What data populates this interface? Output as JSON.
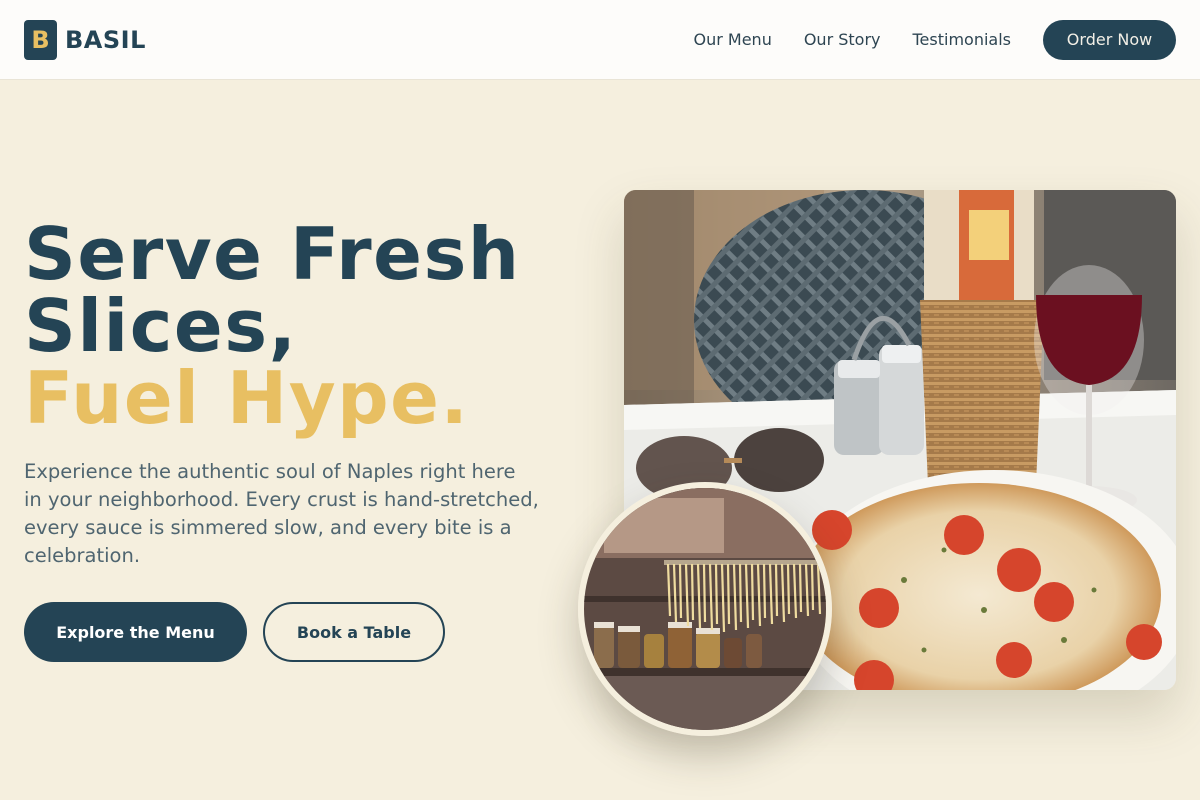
{
  "brand": {
    "logo_letter": "B",
    "name": "BASIL"
  },
  "nav": {
    "links": [
      "Our Menu",
      "Our Story",
      "Testimonials"
    ],
    "cta": "Order Now"
  },
  "hero": {
    "title_line1": "Serve Fresh",
    "title_line2": "Slices,",
    "title_accent": "Fuel Hype.",
    "description": "Experience the authentic soul of Naples right here in your neighborhood. Every crust is hand-stretched, every sauce is simmered slow, and every bite is a celebration.",
    "primary_button": "Explore the Menu",
    "secondary_button": "Book a Table"
  },
  "images": {
    "main": "pizza-and-wine-photo",
    "inset": "fresh-pasta-kitchen-photo"
  },
  "colors": {
    "brand_dark": "#244455",
    "accent_gold": "#e8bf62",
    "page_background": "#f5efde"
  }
}
